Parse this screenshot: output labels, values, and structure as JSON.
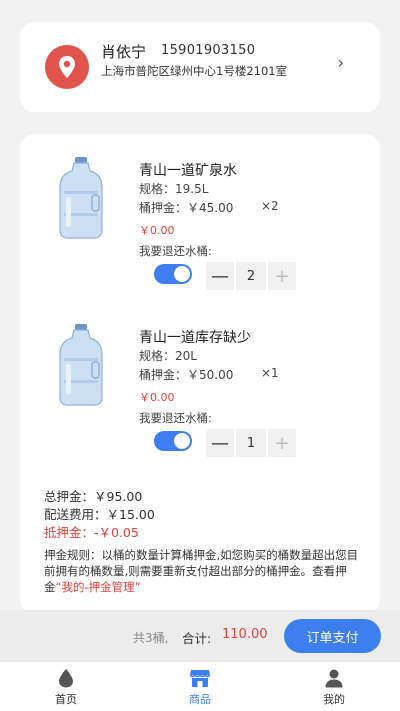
{
  "address": {
    "name": "肖依宁",
    "phone": "15901903150",
    "detail": "上海市普陀区绿州中心1号楼2101室",
    "chevron": "›"
  },
  "items": [
    {
      "title": "青山一道矿泉水",
      "spec": "规格：19.5L",
      "deposit": "桶押金：￥45.00",
      "qty": "×2",
      "red_amount": "￥0.00",
      "return_label": "我要退还水桶:",
      "return_enabled": true,
      "stepper_value": "2"
    },
    {
      "title": "青山一道库存缺少",
      "spec": "规格：20L",
      "deposit": "桶押金：￥50.00",
      "qty": "×1",
      "red_amount": "￥0.00",
      "return_label": "我要退还水桶:",
      "return_enabled": true,
      "stepper_value": "1"
    }
  ],
  "stepper": {
    "minus": "—",
    "plus": "+"
  },
  "summary": {
    "total_deposit": "总押金：￥95.00",
    "delivery_fee": "配送费用：￥15.00",
    "offset_deposit": "抵押金：-￥0.05"
  },
  "rule": {
    "text": "押金规则：以桶的数量计算桶押金,如您购买的桶数量超出您目前拥有的桶数量,则需要重新支付超出部分的桶押金。查看押金",
    "link": "“我的-押金管理”"
  },
  "checkout": {
    "count": "共3桶,",
    "total_label": "合计:",
    "total_value": "110.00",
    "pay_button": "订单支付"
  },
  "tabs": [
    {
      "label": "首页",
      "icon": "drop-icon",
      "active": false
    },
    {
      "label": "商品",
      "icon": "shop-icon",
      "active": true
    },
    {
      "label": "我的",
      "icon": "user-icon",
      "active": false
    }
  ],
  "colors": {
    "accent": "#3d7ff0",
    "red": "#e0443c",
    "location": "#e0544c"
  }
}
